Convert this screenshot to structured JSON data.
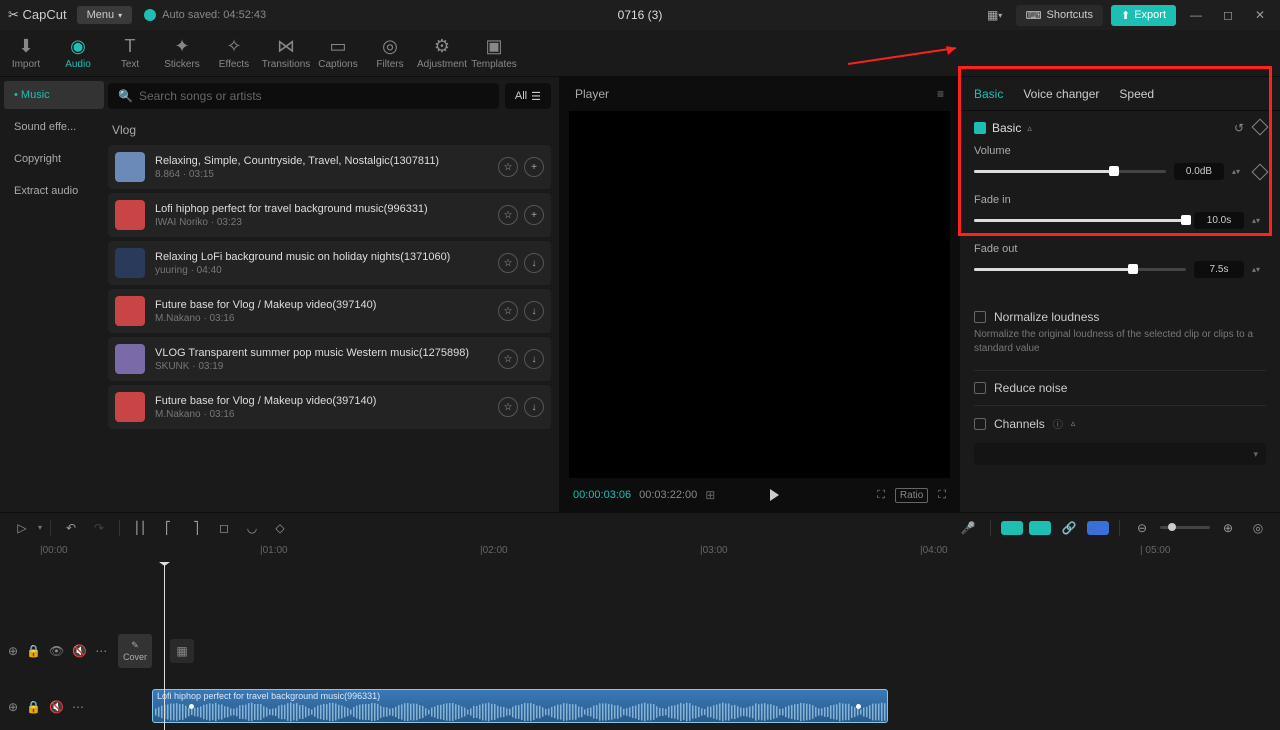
{
  "app": {
    "name": "CapCut",
    "menu": "Menu",
    "autosave": "Auto saved: 04:52:43",
    "title": "0716 (3)",
    "shortcuts": "Shortcuts",
    "export": "Export"
  },
  "tools": [
    {
      "label": "Import",
      "icon": "⬇"
    },
    {
      "label": "Audio",
      "icon": "◉"
    },
    {
      "label": "Text",
      "icon": "T"
    },
    {
      "label": "Stickers",
      "icon": "✦"
    },
    {
      "label": "Effects",
      "icon": "✧"
    },
    {
      "label": "Transitions",
      "icon": "⋈"
    },
    {
      "label": "Captions",
      "icon": "▭"
    },
    {
      "label": "Filters",
      "icon": "◎"
    },
    {
      "label": "Adjustment",
      "icon": "⚙"
    },
    {
      "label": "Templates",
      "icon": "▣"
    }
  ],
  "sidebar": [
    "Music",
    "Sound effe...",
    "Copyright",
    "Extract audio"
  ],
  "search": {
    "placeholder": "Search songs or artists",
    "all": "All"
  },
  "section": "Vlog",
  "songs": [
    {
      "title": "Relaxing, Simple, Countryside, Travel, Nostalgic(1307811)",
      "meta": "8.864 · 03:15",
      "thumb": "#6b8ab8",
      "a1": "☆",
      "a2": "+"
    },
    {
      "title": "Lofi hiphop perfect for travel background music(996331)",
      "meta": "IWAI Noriko · 03:23",
      "thumb": "#c94545",
      "a1": "☆",
      "a2": "+"
    },
    {
      "title": "Relaxing LoFi background music on holiday nights(1371060)",
      "meta": "yuuring · 04:40",
      "thumb": "#2a3a5a",
      "a1": "☆",
      "a2": "↓"
    },
    {
      "title": "Future base for Vlog / Makeup video(397140)",
      "meta": "M.Nakano · 03:16",
      "thumb": "#c94545",
      "a1": "☆",
      "a2": "↓"
    },
    {
      "title": "VLOG Transparent summer pop music Western music(1275898)",
      "meta": "SKUNK · 03:19",
      "thumb": "#7a6aa8",
      "a1": "☆",
      "a2": "↓"
    },
    {
      "title": "Future base for Vlog / Makeup video(397140)",
      "meta": "M.Nakano · 03:16",
      "thumb": "#c94545",
      "a1": "☆",
      "a2": "↓"
    }
  ],
  "player": {
    "label": "Player",
    "cur": "00:00:03:06",
    "dur": "00:03:22:00",
    "ratio": "Ratio"
  },
  "props": {
    "tabs": [
      "Basic",
      "Voice changer",
      "Speed"
    ],
    "basic": "Basic",
    "volume": {
      "label": "Volume",
      "val": "0.0dB",
      "pct": 73
    },
    "fadein": {
      "label": "Fade in",
      "val": "10.0s",
      "pct": 100
    },
    "fadeout": {
      "label": "Fade out",
      "val": "7.5s",
      "pct": 75
    },
    "normalize": {
      "label": "Normalize loudness",
      "help": "Normalize the original loudness of the selected clip or clips to a standard value"
    },
    "reduce": "Reduce noise",
    "channels": "Channels"
  },
  "timeline": {
    "marks": [
      "|00:00",
      "|01:00",
      "|02:00",
      "|03:00",
      "|04:00",
      "| 05:00"
    ],
    "cover": "Cover",
    "clip": "Lofi hiphop perfect for travel background music(996331)"
  }
}
